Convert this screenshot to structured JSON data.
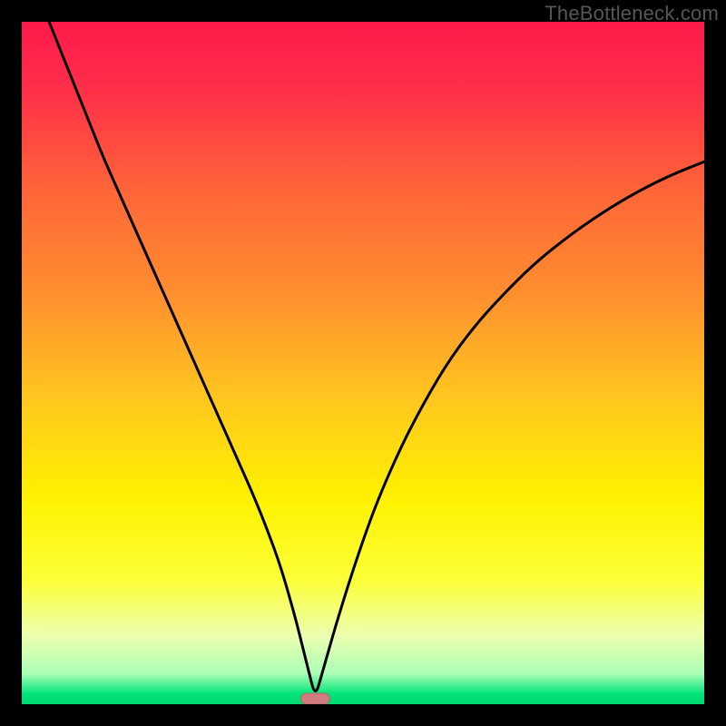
{
  "watermark": "TheBottleneck.com",
  "colors": {
    "gradient_stops": [
      {
        "offset": 0.0,
        "color": "#ff1a4b"
      },
      {
        "offset": 0.1,
        "color": "#ff2f49"
      },
      {
        "offset": 0.25,
        "color": "#ff6638"
      },
      {
        "offset": 0.4,
        "color": "#ff8f2f"
      },
      {
        "offset": 0.55,
        "color": "#ffc61f"
      },
      {
        "offset": 0.7,
        "color": "#fff200"
      },
      {
        "offset": 0.82,
        "color": "#fcff3a"
      },
      {
        "offset": 0.9,
        "color": "#ecffb0"
      },
      {
        "offset": 0.955,
        "color": "#aaffb5"
      },
      {
        "offset": 0.985,
        "color": "#00e47a"
      },
      {
        "offset": 1.0,
        "color": "#00d870"
      }
    ],
    "curve": "#000000",
    "marker_fill": "#cf7b7f",
    "marker_stroke": "#b96368"
  },
  "chart_data": {
    "type": "line",
    "title": "",
    "xlabel": "",
    "ylabel": "",
    "xlim": [
      0,
      100
    ],
    "ylim": [
      0,
      100
    ],
    "grid": false,
    "legend": false,
    "minimum_x": 43,
    "series": [
      {
        "name": "curve",
        "x": [
          4,
          6,
          8,
          10,
          12,
          14,
          16,
          18,
          20,
          22,
          24,
          26,
          28,
          30,
          32,
          34,
          36,
          38,
          40,
          41,
          42,
          43,
          44,
          45,
          46,
          48,
          50,
          52,
          55,
          58,
          62,
          66,
          70,
          75,
          80,
          85,
          90,
          95,
          100
        ],
        "y": [
          100,
          95,
          90,
          85,
          80,
          75.5,
          71,
          66.5,
          62,
          57.5,
          53,
          48.5,
          44,
          39.5,
          35,
          30.5,
          25.5,
          20,
          13,
          9,
          5,
          1.0,
          4.5,
          8,
          11.5,
          18,
          24,
          29.5,
          36.5,
          42.5,
          49.5,
          55,
          59.5,
          64.5,
          68.5,
          72,
          75,
          77.5,
          79.5
        ]
      }
    ],
    "marker": {
      "x": 43,
      "y": 0.8,
      "w": 4.2,
      "h": 1.6
    }
  }
}
